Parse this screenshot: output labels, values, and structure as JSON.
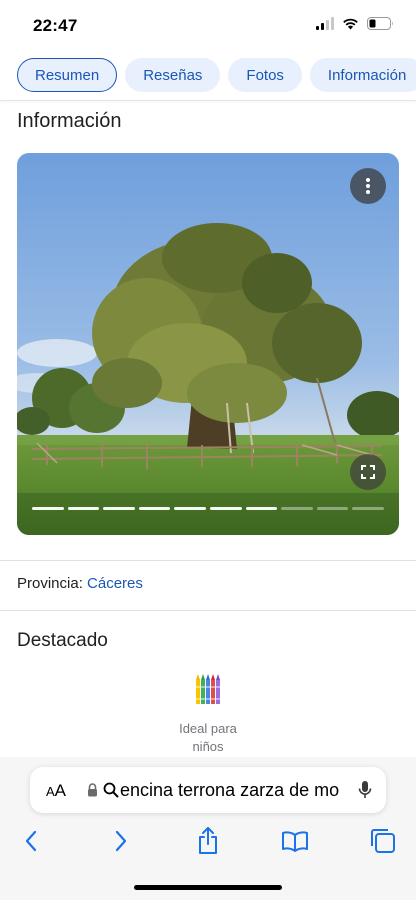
{
  "status_bar": {
    "time": "22:47"
  },
  "tabs": [
    {
      "label": "Resumen",
      "active": true
    },
    {
      "label": "Reseñas",
      "active": false
    },
    {
      "label": "Fotos",
      "active": false
    },
    {
      "label": "Información",
      "active": false
    }
  ],
  "main": {
    "section_title": "Información",
    "photo": {
      "slides_total": 10,
      "slides_viewed": 7,
      "more_icon": "more-vert-icon",
      "expand_icon": "fullscreen-icon"
    },
    "province_label": "Provincia: ",
    "province_value": "Cáceres",
    "highlights_title": "Destacado",
    "highlight": {
      "icon": "crayons-icon",
      "label_line1": "Ideal para",
      "label_line2": "niños"
    }
  },
  "browser": {
    "text_size_label": "AA",
    "url_text": "encina terrona zarza de mo",
    "toolbar": [
      "back-icon",
      "forward-icon",
      "share-icon",
      "bookmarks-icon",
      "tabs-icon"
    ]
  },
  "colors": {
    "accent": "#1a57b5",
    "tab_bg": "#e8f0fe",
    "text": "#202124",
    "muted": "#70757a"
  }
}
